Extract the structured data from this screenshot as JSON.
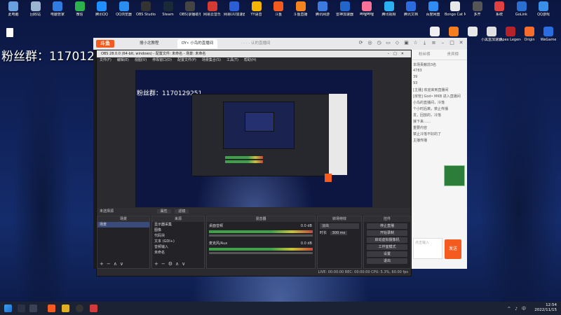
{
  "desktop": {
    "fans_text": "粉丝群：1170129251",
    "icons": [
      {
        "label": "此电脑",
        "color": "#6aa0e0"
      },
      {
        "label": "回收站",
        "color": "#9bb4d0"
      },
      {
        "label": "电脑管家",
        "color": "#2f7de0"
      },
      {
        "label": "微信",
        "color": "#2bb24c"
      },
      {
        "label": "腾讯QQ",
        "color": "#1e90ff"
      },
      {
        "label": "QQ浏览器",
        "color": "#2a8ef0"
      },
      {
        "label": "OBS Studio",
        "color": "#333333"
      },
      {
        "label": "Steam",
        "color": "#1b2838"
      },
      {
        "label": "OBS(录播助手)",
        "color": "#444444"
      },
      {
        "label": "网易云音乐",
        "color": "#d33a31"
      },
      {
        "label": "网易UU加速器",
        "color": "#2c5fd6"
      },
      {
        "label": "YY语音",
        "color": "#f5b400"
      },
      {
        "label": "斗鱼",
        "color": "#f55a1e"
      },
      {
        "label": "斗鱼直播",
        "color": "#f5841e"
      },
      {
        "label": "腾讯网游",
        "color": "#3b7ae0"
      },
      {
        "label": "雷神加速器",
        "color": "#2266cc"
      },
      {
        "label": "哔哩哔哩",
        "color": "#fb7299"
      },
      {
        "label": "腾讯视频",
        "color": "#2ab0f0"
      },
      {
        "label": "腾讯文档",
        "color": "#2b6de0"
      },
      {
        "label": "百度网盘",
        "color": "#2f8cf4"
      },
      {
        "label": "Bongo Cat Mver",
        "color": "#e8e8e8"
      },
      {
        "label": "多开",
        "color": "#555555"
      },
      {
        "label": "系统",
        "color": "#e04040"
      },
      {
        "label": "GoLink",
        "color": "#2a70d0"
      },
      {
        "label": "QQ游戏",
        "color": "#3a90e8"
      }
    ],
    "side_icons": [
      {
        "label": "",
        "color": "#f0f0f0"
      },
      {
        "label": "",
        "color": "#f57d1e"
      },
      {
        "label": "",
        "color": "#e8e8e8"
      },
      {
        "label": "小黑盒加速器",
        "color": "#e0e0e0"
      },
      {
        "label": "Apex Legends",
        "color": "#b4232a"
      },
      {
        "label": "Origin",
        "color": "#f56c2d"
      },
      {
        "label": "WeGame",
        "color": "#2a6de0"
      }
    ]
  },
  "browser": {
    "logo_text": "斗鱼",
    "tabs": [
      "搜小北教程",
      "DY• 小鸟的直播间",
      "· · · · 认的直播间"
    ],
    "chat_tabs": [
      "粉丝榜",
      "贵宾榜"
    ],
    "chat_lines": [
      "本场贡献前3名",
      "4783",
      "39",
      "93",
      "[主播] 欢迎来到直播间",
      "[房管] God• MKB 进入直播间",
      "小鸟的直播间，冷落",
      "个小时后离，禁止传播",
      "发，回放的，冷落",
      "接下来……",
      "重要内容",
      "禁止冷落不好的了",
      "主播传播"
    ],
    "send_label": "发送",
    "input_placeholder": "点击输入"
  },
  "obs": {
    "title": "OBS 28.0.0 (64-bit, windows) - 配置文件: 未命名 - 场景: 未命名",
    "menu": [
      "文件(F)",
      "编辑(E)",
      "视图(V)",
      "停靠窗口(D)",
      "配置文件(P)",
      "场景集合(S)",
      "工具(T)",
      "帮助(H)"
    ],
    "preview_fans": "粉丝群：1170129251",
    "scene_bar": "未选择源",
    "scene_bar_buttons": [
      "属性",
      "滤镜"
    ],
    "docks": {
      "scenes": {
        "title": "场景",
        "items": [
          "场景"
        ]
      },
      "sources": {
        "title": "来源",
        "items": [
          "显示器采集",
          "图像",
          "代码块",
          "文本 (GDI+)",
          "音频输入",
          "未命名"
        ]
      },
      "mixer": {
        "title": "混音器",
        "tracks": [
          {
            "name": "桌面音频",
            "db": "0.0 dB"
          },
          {
            "name": "麦克风/Aux",
            "db": "0.0 dB"
          }
        ]
      },
      "transitions": {
        "title": "转场特效",
        "type": "淡出",
        "duration_label": "时长",
        "duration": "300 ms"
      },
      "controls": {
        "title": "控件",
        "buttons": [
          "停止直播",
          "开始录制",
          "启动虚拟摄像机",
          "工作室模式",
          "设置",
          "退出"
        ]
      }
    },
    "status": "LIVE: 00:00:00   REC: 00:00:00   CPU: 5.3%, 60.00 fps"
  },
  "taskbar": {
    "time": "12:54",
    "date": "2022/11/15",
    "tray": "^ ♪ 中"
  }
}
